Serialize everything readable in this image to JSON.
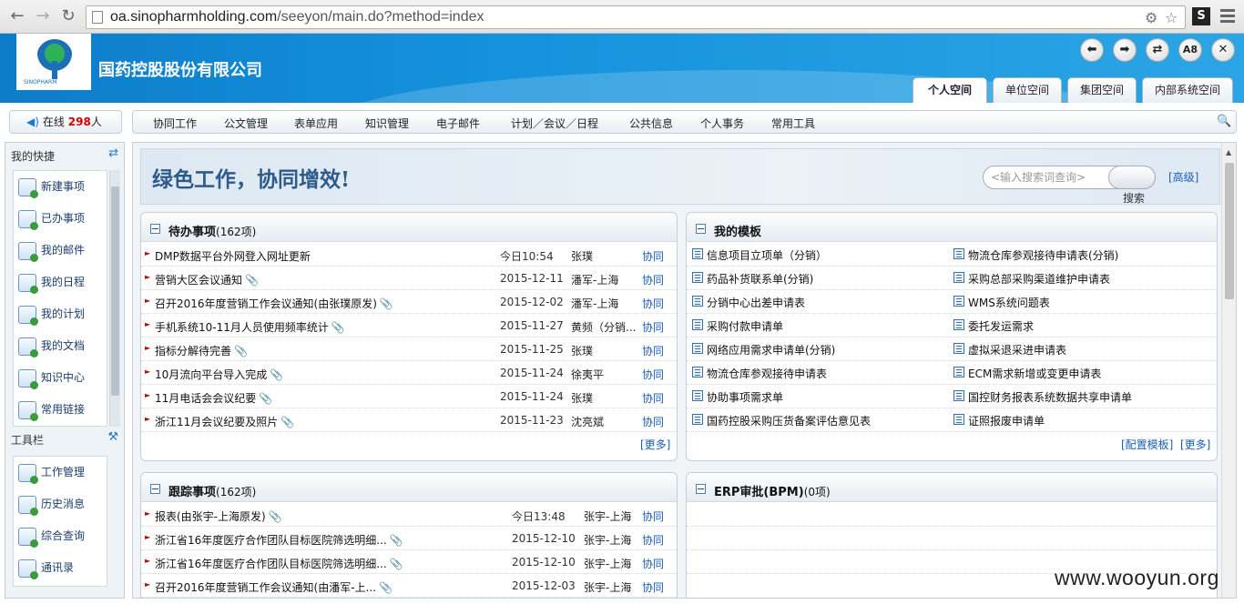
{
  "browser": {
    "url_host": "oa.sinopharmholding.com",
    "url_path": "/seeyon/main.do?method=index",
    "extension_label": "S"
  },
  "header": {
    "company": "国药控股股份有限公司",
    "logo_text": "SINOPHARM",
    "buttons": {
      "a8": "A8"
    },
    "space_tabs": [
      "个人空间",
      "单位空间",
      "集团空间",
      "内部系统空间"
    ]
  },
  "online": {
    "prefix": "在线",
    "count": "298",
    "suffix": "人"
  },
  "menu": [
    "协同工作",
    "公文管理",
    "表单应用",
    "知识管理",
    "电子邮件",
    "计划／会议／日程",
    "公共信息",
    "个人事务",
    "常用工具"
  ],
  "sidebar": {
    "shortcuts_title": "我的快捷",
    "shortcuts": [
      "新建事项",
      "已办事项",
      "我的邮件",
      "我的日程",
      "我的计划",
      "我的文档",
      "知识中心",
      "常用链接"
    ],
    "toolbar_title": "工具栏",
    "tools": [
      "工作管理",
      "历史消息",
      "综合查询",
      "通讯录"
    ]
  },
  "banner": {
    "slogan": "绿色工作，协同增效!",
    "search_placeholder": "<输入搜索词查询>",
    "search_label": "搜索",
    "advanced": "[高级]"
  },
  "pending": {
    "title": "待办事项",
    "count": "(162项)",
    "rows": [
      {
        "title": "DMP数据平台外网登入网址更新",
        "date": "今日10:54",
        "person": "张璞",
        "type": "协同",
        "attach": false
      },
      {
        "title": "营销大区会议通知",
        "date": "2015-12-11",
        "person": "潘军-上海",
        "type": "协同",
        "attach": true
      },
      {
        "title": "召开2016年度营销工作会议通知(由张璞原发)",
        "date": "2015-12-02",
        "person": "潘军-上海",
        "type": "协同",
        "attach": true
      },
      {
        "title": "手机系统10-11月人员使用频率统计",
        "date": "2015-11-27",
        "person": "黄频（分销...",
        "type": "协同",
        "attach": true
      },
      {
        "title": "指标分解待完善",
        "date": "2015-11-25",
        "person": "张璞",
        "type": "协同",
        "attach": true
      },
      {
        "title": "10月流向平台导入完成",
        "date": "2015-11-24",
        "person": "徐夷平",
        "type": "协同",
        "attach": true
      },
      {
        "title": "11月电话会会议纪要",
        "date": "2015-11-24",
        "person": "张璞",
        "type": "协同",
        "attach": true
      },
      {
        "title": "浙江11月会议纪要及照片",
        "date": "2015-11-23",
        "person": "沈亮斌",
        "type": "协同",
        "attach": true
      }
    ],
    "more": "[更多]"
  },
  "templates": {
    "title": "我的模板",
    "items": [
      "信息项目立项单（分销）",
      "物流仓库参观接待申请表(分销)",
      "药品补货联系单(分销)",
      "采购总部采购渠道维护申请表",
      "分销中心出差申请表",
      "WMS系统问题表",
      "采购付款申请单",
      "委托发运需求",
      "网络应用需求申请单(分销)",
      "虚拟采退采进申请表",
      "物流仓库参观接待申请表",
      "ECM需求新增或变更申请表",
      "协助事项需求单",
      "国控财务报表系统数据共享申请单",
      "国药控股采购压货备案评估意见表",
      "证照报废申请单"
    ],
    "config": "[配置模板]",
    "more": "[更多]"
  },
  "tracking": {
    "title": "跟踪事项",
    "count": "(162项)",
    "rows": [
      {
        "title": "报表(由张宇-上海原发)",
        "date": "今日13:48",
        "person": "张宇-上海",
        "type": "协同",
        "attach": true
      },
      {
        "title": "浙江省16年度医疗合作团队目标医院筛选明细...",
        "date": "2015-12-10",
        "person": "张宇-上海",
        "type": "协同",
        "attach": true
      },
      {
        "title": "浙江省16年度医疗合作团队目标医院筛选明细...",
        "date": "2015-12-10",
        "person": "张宇-上海",
        "type": "协同",
        "attach": true
      },
      {
        "title": "召开2016年度营销工作会议通知(由潘军-上...",
        "date": "2015-12-03",
        "person": "张宇-上海",
        "type": "协同",
        "attach": true
      }
    ]
  },
  "erp": {
    "title": "ERP审批(BPM)",
    "count": "(0项)"
  },
  "watermark": "www.wooyun.org",
  "colors": {
    "header_blue": "#1592dc",
    "link_blue": "#1a5eb3",
    "online_red": "#d40000"
  }
}
